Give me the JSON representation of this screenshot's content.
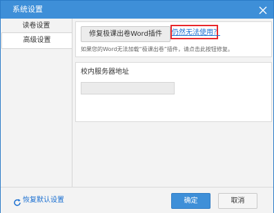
{
  "window": {
    "title": "系统设置"
  },
  "sidebar": {
    "items": [
      {
        "label": "读卷设置",
        "active": false
      },
      {
        "label": "高级设置",
        "active": true
      }
    ]
  },
  "main": {
    "repair_button_label": "修复极课出卷Word插件",
    "help_link_text": "仍然无法使用？",
    "hint_text": "如果您的Word无法加载“极课出卷”插件，请点击此按钮修复。",
    "server_address_label": "校内服务器地址",
    "server_address_value": "",
    "server_address_placeholder": ""
  },
  "footer": {
    "restore_label": "恢复默认设置",
    "ok_label": "确定",
    "cancel_label": "取消"
  },
  "colors": {
    "titlebar": "#3e8fd8",
    "accent": "#1a6fd1",
    "highlight_border": "#e8262a"
  },
  "icons": {
    "close": "close-icon",
    "restore": "refresh-icon"
  }
}
